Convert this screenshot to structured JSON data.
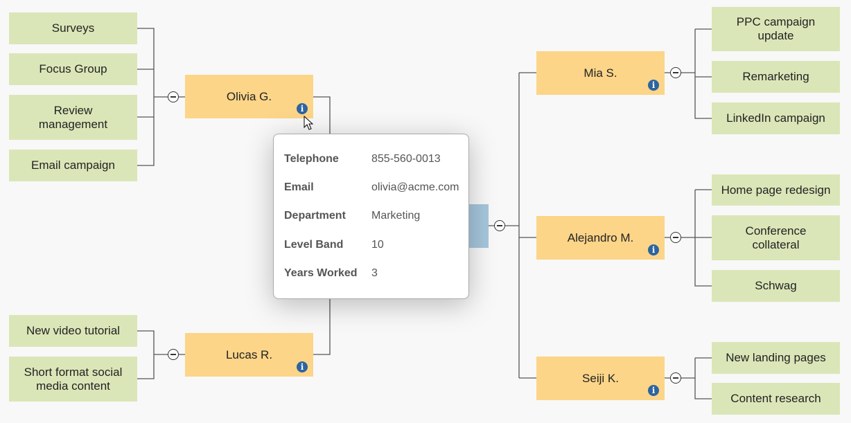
{
  "root": {
    "label": ""
  },
  "left": [
    {
      "name": "Olivia G.",
      "children": [
        "Surveys",
        "Focus Group",
        "Review management",
        "Email campaign"
      ]
    },
    {
      "name": "Lucas R.",
      "children": [
        "New video tutorial",
        "Short format social media content"
      ]
    }
  ],
  "right": [
    {
      "name": "Mia S.",
      "children": [
        "PPC campaign update",
        "Remarketing",
        "LinkedIn campaign"
      ]
    },
    {
      "name": "Alejandro M.",
      "children": [
        "Home page redesign",
        "Conference collateral",
        "Schwag"
      ]
    },
    {
      "name": "Seiji K.",
      "children": [
        "New landing pages",
        "Content research"
      ]
    }
  ],
  "popup": {
    "rows": [
      {
        "label": "Telephone",
        "value": "855-560-0013"
      },
      {
        "label": "Email",
        "value": "olivia@acme.com"
      },
      {
        "label": "Department",
        "value": "Marketing"
      },
      {
        "label": "Level Band",
        "value": "10"
      },
      {
        "label": "Years Worked",
        "value": "3"
      }
    ]
  },
  "icons": {
    "info": "info-icon",
    "toggle": "collapse-minus-icon",
    "cursor": "mouse-pointer-icon"
  },
  "colors": {
    "leaf": "#dbe6b8",
    "person": "#fcd588",
    "root": "#a6c6dc",
    "info": "#2e64a0"
  }
}
